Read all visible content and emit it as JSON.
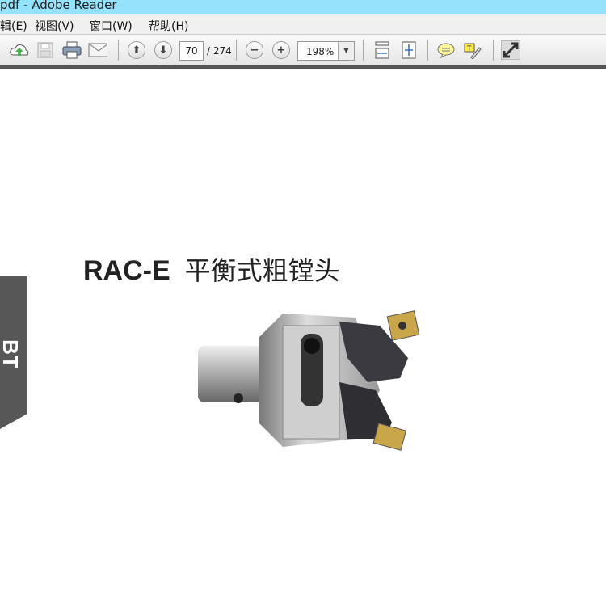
{
  "window": {
    "title": "pdf - Adobe Reader"
  },
  "menu": [
    "辑(E)",
    "视图(V)",
    "窗口(W)",
    "帮助(H)"
  ],
  "toolbar": {
    "page_current": "70",
    "page_total": "/ 274",
    "zoom": "198%"
  },
  "document": {
    "model": "RAC-E",
    "title_cn": "平衡式粗镗头",
    "side_tab": "BT"
  }
}
